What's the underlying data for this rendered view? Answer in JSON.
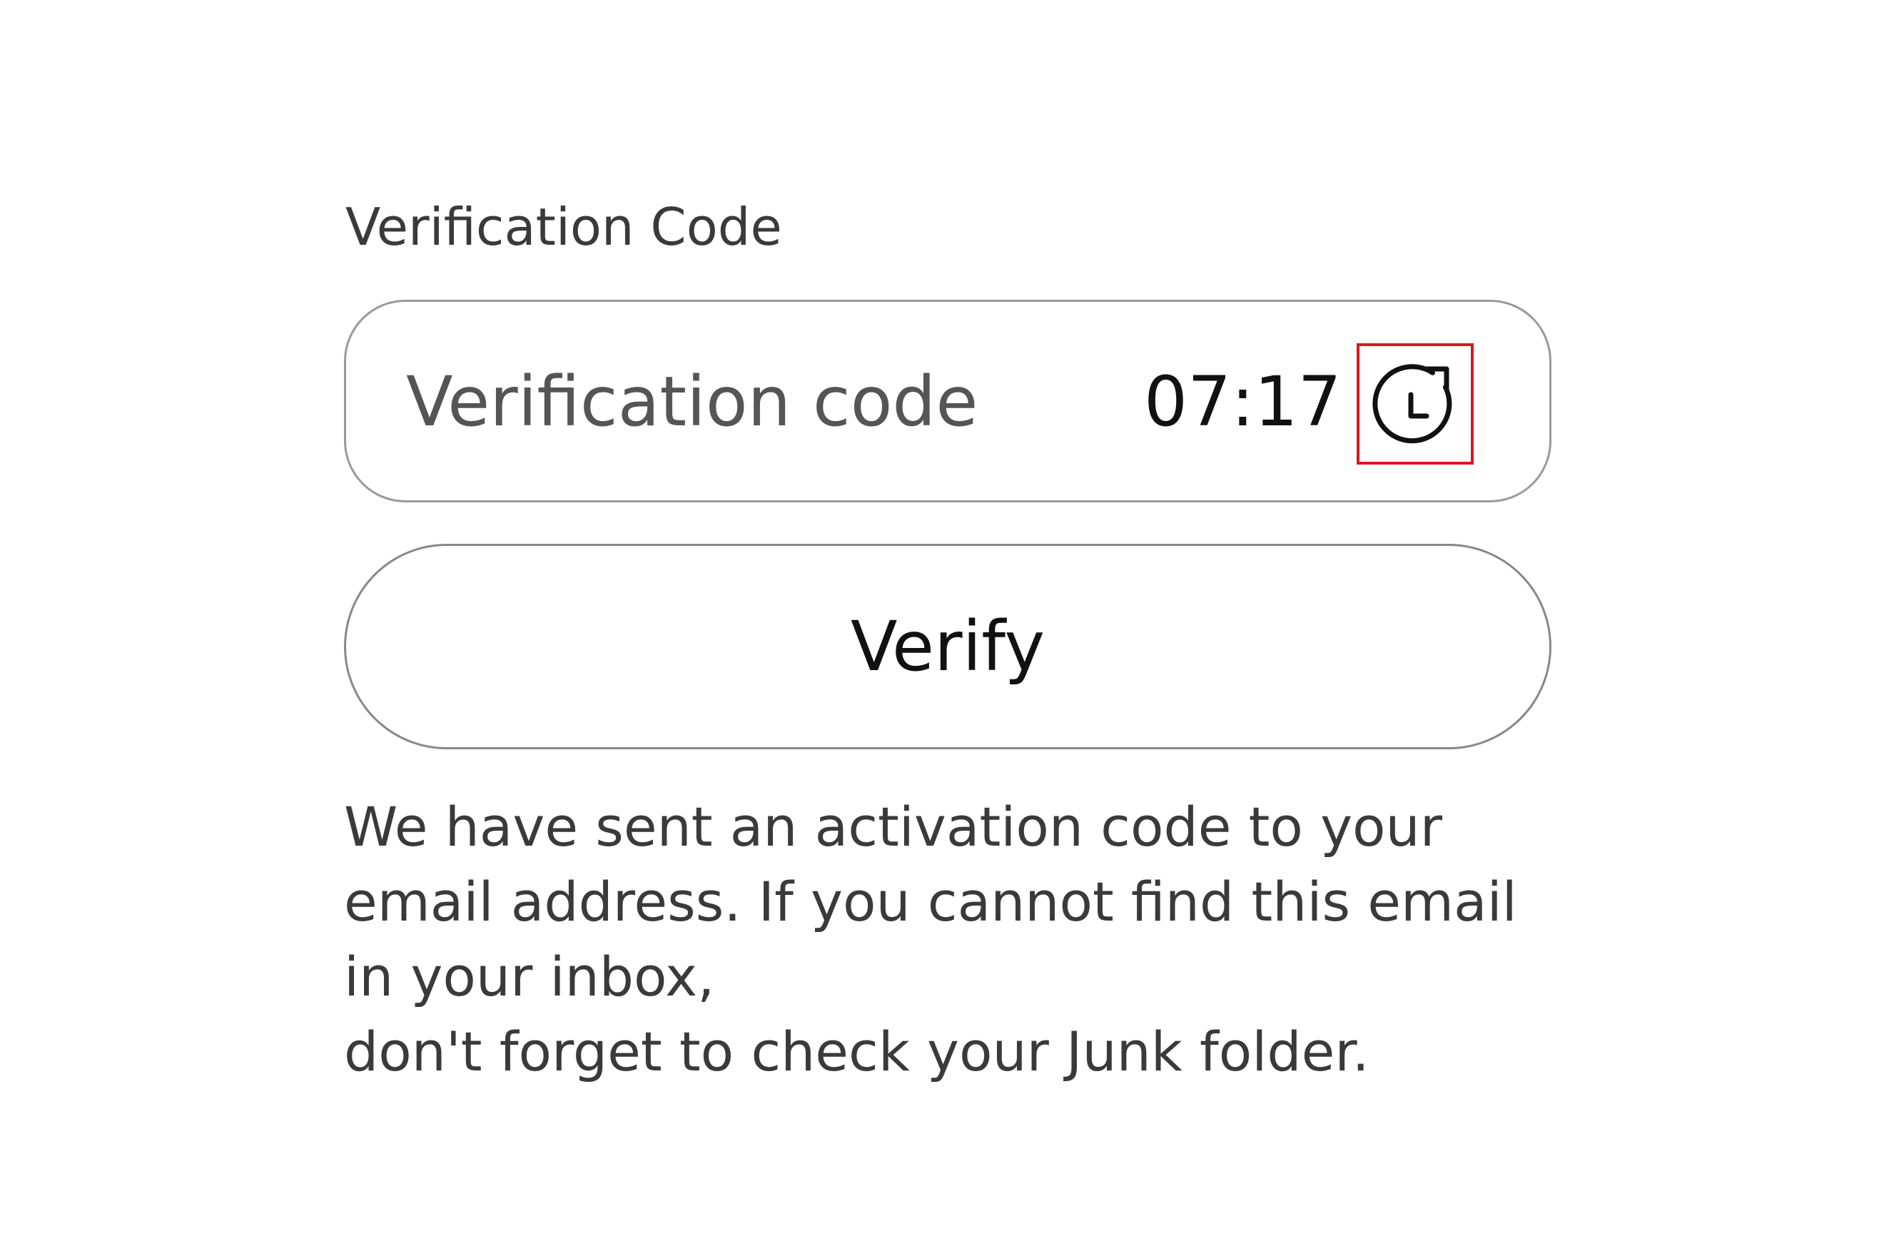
{
  "form": {
    "field_label": "Verification Code",
    "input": {
      "value": "",
      "placeholder": "Verification code"
    },
    "timer": "07:17",
    "resend_icon": "refresh-clock-icon",
    "verify_label": "Verify",
    "info_lines": [
      "We have sent an activation code to your",
      "email address. If you cannot find this email",
      "in your inbox,",
      "don't forget to check your Junk folder."
    ]
  },
  "colors": {
    "highlight_border": "#e0141e",
    "text_dark": "#111111",
    "text_muted": "#3a3a3a",
    "border": "#9a9a9a"
  }
}
